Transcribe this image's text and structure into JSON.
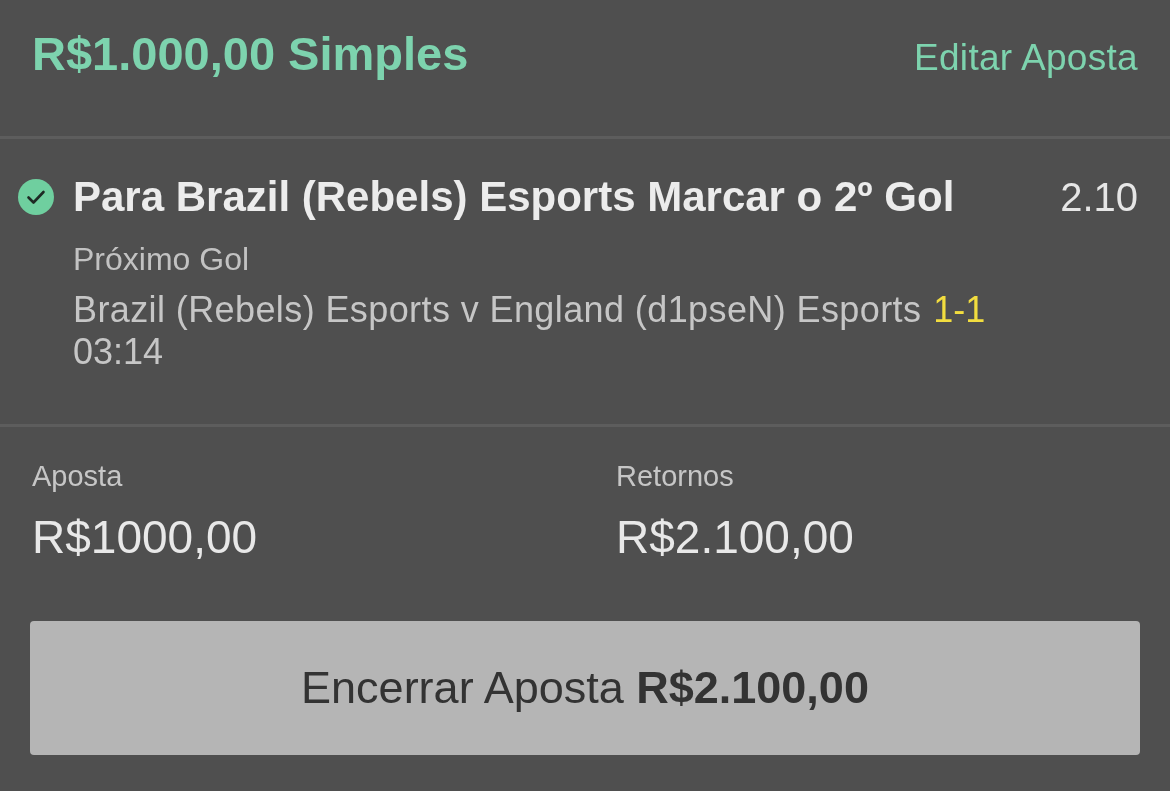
{
  "header": {
    "title": "R$1.000,00 Simples",
    "edit_link": "Editar Aposta"
  },
  "selection": {
    "title": "Para Brazil (Rebels) Esports Marcar o 2º Gol",
    "odds": "2.10",
    "market": "Próximo Gol",
    "event": "Brazil (Rebels) Esports v England (d1pseN) Esports",
    "score": "1-1",
    "time": "03:14"
  },
  "summary": [
    {
      "label": "Aposta",
      "value": "R$1000,00"
    },
    {
      "label": "Retornos",
      "value": "R$2.100,00"
    }
  ],
  "cashout_button": {
    "label": "Encerrar Aposta **R$2.100,00**"
  }
}
